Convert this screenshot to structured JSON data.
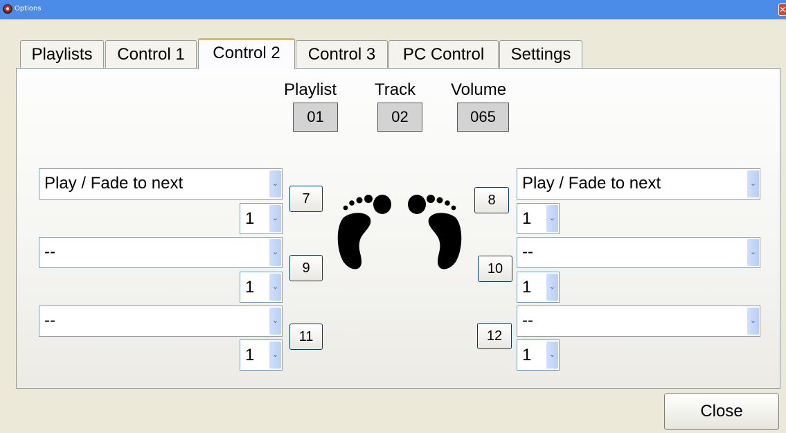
{
  "window": {
    "title": "Options",
    "close_glyph": "✕"
  },
  "tabs": [
    {
      "label": "Playlists"
    },
    {
      "label": "Control 1"
    },
    {
      "label": "Control 2",
      "active": true
    },
    {
      "label": "Control 3"
    },
    {
      "label": "PC Control"
    },
    {
      "label": "Settings"
    }
  ],
  "status": {
    "playlist_label": "Playlist",
    "playlist_value": "01",
    "track_label": "Track",
    "track_value": "02",
    "volume_label": "Volume",
    "volume_value": "065"
  },
  "icons": {
    "feet": "footprints-icon",
    "dropdown": "chevron-down-icon",
    "window": "app-icon"
  },
  "left_controls": [
    {
      "button": "7",
      "action": "Play / Fade to next",
      "count": "1"
    },
    {
      "button": "9",
      "action": "--",
      "count": "1"
    },
    {
      "button": "11",
      "action": "--",
      "count": "1"
    }
  ],
  "right_controls": [
    {
      "button": "8",
      "action": "Play / Fade to next",
      "count": "1"
    },
    {
      "button": "10",
      "action": "--",
      "count": "1"
    },
    {
      "button": "12",
      "action": "--",
      "count": "1"
    }
  ],
  "arrow_glyph": "⌄",
  "close_label": "Close",
  "colors": {
    "titlebar": "#4a8ce8",
    "active_tab_accent": "#f0b53a",
    "dialog_bg": "#ece9d8"
  }
}
